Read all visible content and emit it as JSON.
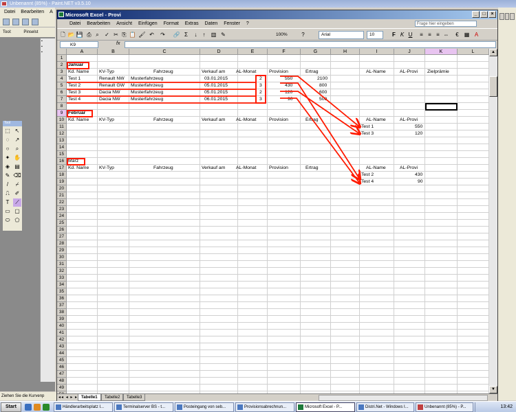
{
  "paintnet": {
    "title": "Unbenannt (85%) - Paint.NET v3.5.10",
    "menu": [
      "Datei",
      "Bearbeiten",
      "A"
    ],
    "tool_label": "Tool:",
    "tool_option": "Pinselst",
    "status": "Ziehen Sie die Kurvenp"
  },
  "excel": {
    "title": "Microsoft Excel - Provi",
    "menu": [
      "Datei",
      "Bearbeiten",
      "Ansicht",
      "Einfügen",
      "Format",
      "Extras",
      "Daten",
      "Fenster",
      "?"
    ],
    "ask_placeholder": "Frage hier eingeben",
    "zoom": "100%",
    "font": "Arial",
    "font_size": "10",
    "namebox": "K9",
    "fx": "fx",
    "columns": [
      "A",
      "B",
      "C",
      "D",
      "E",
      "F",
      "G",
      "H",
      "I",
      "J",
      "K",
      "L"
    ],
    "rows": [
      "1",
      "2",
      "3",
      "4",
      "5",
      "6",
      "7",
      "8",
      "9",
      "10",
      "11",
      "12",
      "13",
      "14",
      "15",
      "16",
      "17",
      "18",
      "19",
      "20",
      "21",
      "22",
      "23",
      "24",
      "25",
      "26",
      "27",
      "28",
      "29",
      "30",
      "31",
      "32",
      "33",
      "34",
      "35",
      "36",
      "37",
      "38",
      "39",
      "40",
      "41",
      "42",
      "43",
      "44",
      "45",
      "46",
      "47",
      "48",
      "49",
      "50"
    ],
    "sections": {
      "januar": "Januar",
      "februar": "Februar",
      "maerz": "März"
    },
    "headers": {
      "kd_name": "Kd. Name",
      "kv_typ": "KV-Typ",
      "fahrzeug": "Fahrzeug",
      "verkauf": "Verkauf am",
      "al_monat": "AL-Monat",
      "provision": "Provision",
      "ertrag": "Ertrag",
      "al_name": "AL-Name",
      "al_provi": "AL-Provi",
      "zielpraemie": "Zielprämie"
    },
    "januar_rows": [
      {
        "name": "Test 1",
        "typ": "Renault NW",
        "fahrzeug": "Musterfahrzeug",
        "datum": "03.01.2015",
        "monat": "2",
        "provision": "550",
        "ertrag": "2100"
      },
      {
        "name": "Test 2",
        "typ": "Renault GW",
        "fahrzeug": "Musterfahrzeug",
        "datum": "05.01.2015",
        "monat": "3",
        "provision": "430",
        "ertrag": "800"
      },
      {
        "name": "Test 3",
        "typ": "Dacia NW",
        "fahrzeug": "Musterfahrzeug",
        "datum": "05.01.2015",
        "monat": "2",
        "provision": "120",
        "ertrag": "600"
      },
      {
        "name": "Test 4",
        "typ": "Dacia NW",
        "fahrzeug": "Musterfahrzeug",
        "datum": "06.01.2015",
        "monat": "3",
        "provision": "90",
        "ertrag": "500"
      }
    ],
    "februar_al": [
      {
        "name": "Test 1",
        "provi": "550"
      },
      {
        "name": "Test 3",
        "provi": "120"
      }
    ],
    "maerz_al": [
      {
        "name": "Test 2",
        "provi": "430"
      },
      {
        "name": "Test 4",
        "provi": "90"
      }
    ],
    "sheets": [
      "Tabelle1",
      "Tabelle2",
      "Tabelle3"
    ]
  },
  "taskbar": {
    "start": "Start",
    "tasks": [
      "Händlerarbeitsplatz I...",
      "Terminalserver BS - t...",
      "Posteingang von seb...",
      "Provisionsabrechnun...",
      "Microsoft Excel - P...",
      "Distri.Net - Windows I...",
      "Unbenannt (85%) - P..."
    ],
    "clock": "13:42"
  },
  "colors": {
    "accent_red": "#ff1a00",
    "title_blue": "#0a246a",
    "selected_col": "#e8c4f0"
  }
}
